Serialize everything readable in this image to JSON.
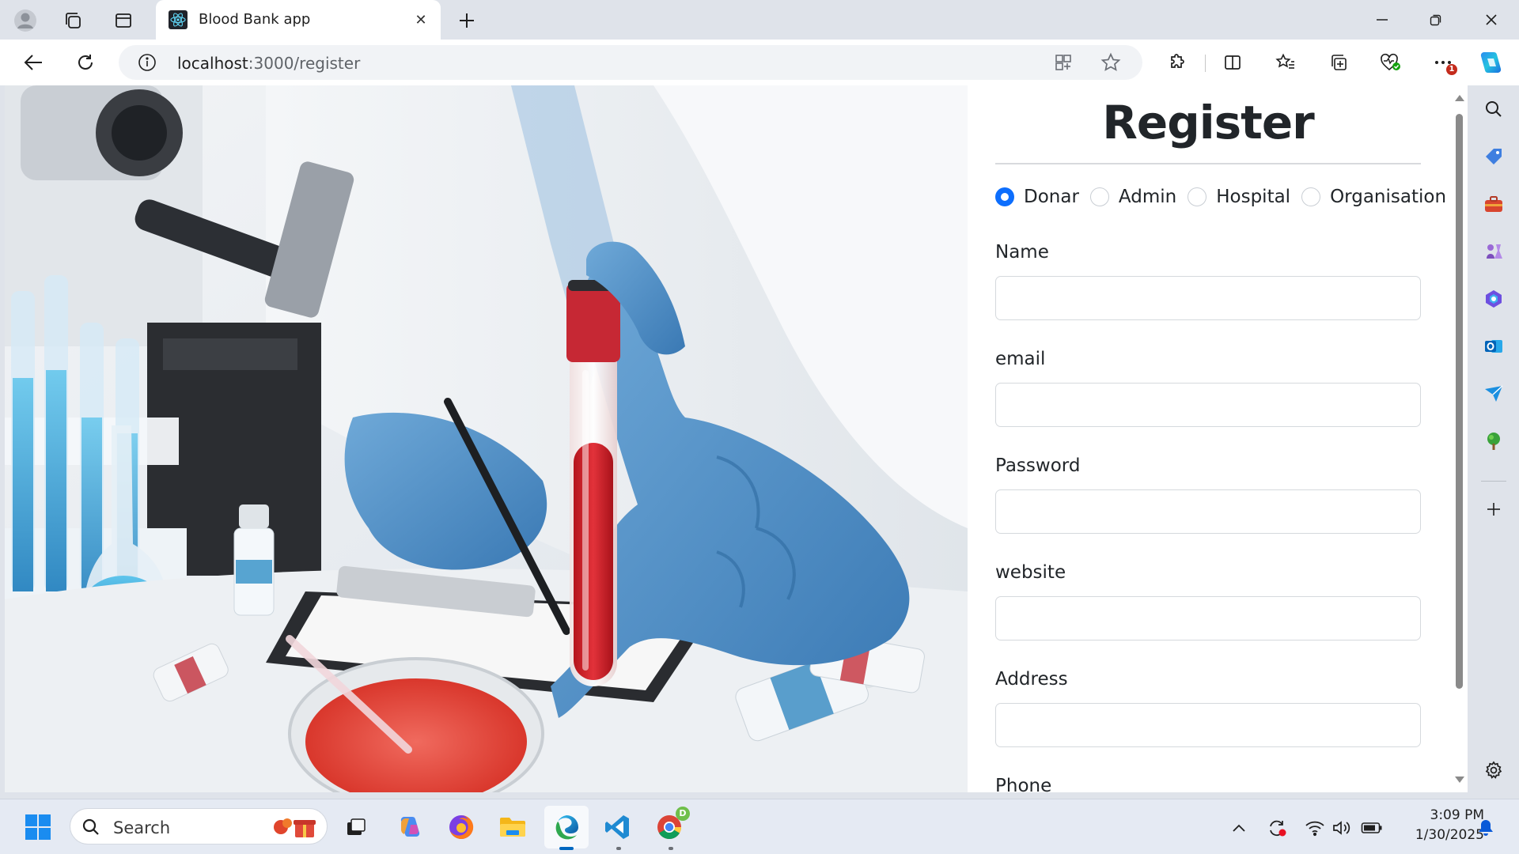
{
  "browser": {
    "tab_title": "Blood Bank app",
    "url_host": "localhost",
    "url_path": ":3000/register",
    "more_badge": "1"
  },
  "form": {
    "title": "Register",
    "roles": [
      {
        "label": "Donar",
        "checked": true
      },
      {
        "label": "Admin",
        "checked": false
      },
      {
        "label": "Hospital",
        "checked": false
      },
      {
        "label": "Organisation",
        "checked": false
      }
    ],
    "fields": [
      {
        "label": "Name",
        "value": ""
      },
      {
        "label": "email",
        "value": ""
      },
      {
        "label": "Password",
        "value": ""
      },
      {
        "label": "website",
        "value": ""
      },
      {
        "label": "Address",
        "value": ""
      },
      {
        "label": "Phone",
        "value": ""
      }
    ]
  },
  "taskbar": {
    "search_placeholder": "Search",
    "time": "3:09 PM",
    "date": "1/30/2025",
    "chrome_badge": "D"
  },
  "colors": {
    "accent": "#0d6efd",
    "edge_blue": "#0067c0"
  }
}
